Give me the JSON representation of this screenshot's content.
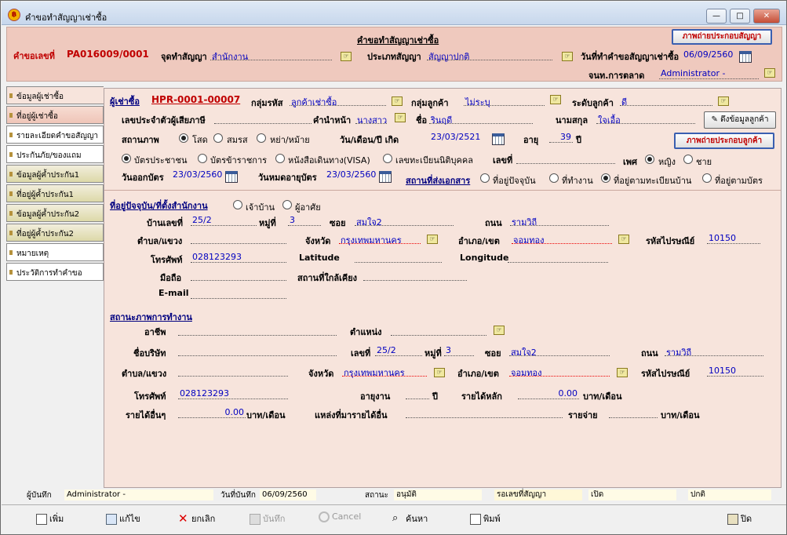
{
  "window": {
    "title": "คำขอทำสัญญาเช่าซื้อ",
    "minimize": "—",
    "maximize": "□",
    "close": "✕"
  },
  "header": {
    "form_title": "คำขอทำสัญญาเช่าซื้อ",
    "print_contract_btn": "ภาพถ่ายประกอบสัญญา",
    "request_no_label": "คำขอเลขที่",
    "request_no": "PA016009/0001",
    "place_label": "จุดทำสัญญา",
    "place": "สำนักงาน",
    "type_label": "ประเภทสัญญา",
    "type": "สัญญาปกติ",
    "date_label": "วันที่ทำคำขอสัญญาเช่าซื้อ",
    "date": "06/09/2560",
    "officer_label": "จนท.การตลาด",
    "officer": "Administrator -"
  },
  "tabs": [
    "ข้อมูลผู้เช่าซื้อ",
    "ที่อยู่ผู้เช่าซื้อ",
    "รายละเอียดคำขอสัญญา",
    "ประกันภัย/ของแถม",
    "ข้อมูลผู้ค้ำประกัน1",
    "ที่อยู่ผู้ค้ำประกัน1",
    "ข้อมูลผู้ค้ำประกัน2",
    "ที่อยู่ผู้ค้ำประกัน2",
    "หมายเหตุ",
    "ประวัติการทำคำขอ"
  ],
  "customer": {
    "label": "ผู้เช่าซื้อ",
    "id": "HPR-0001-00007",
    "group_code_label": "กลุ่มรหัส",
    "group_code": "ลูกค้าเช่าซื้อ",
    "group_label": "กลุ่มลูกค้า",
    "group": "ไม่ระบุ",
    "level_label": "ระดับลูกค้า",
    "level": "ดี",
    "taxid_label": "เลขประจำตัวผู้เสียภาษี",
    "prefix_label": "คำนำหน้า",
    "prefix": "นางสาว",
    "name_label": "ชื่อ",
    "name": "รินฤดี",
    "surname_label": "นามสกุล",
    "surname": "ใจเอื้อ",
    "pull_btn": "ดึงข้อมูลลูกค้า",
    "marital_label": "สถานภาพ",
    "marital": [
      "โสด",
      "สมรส",
      "หย่า/หม้าย"
    ],
    "dob_label": "วัน/เดือน/ปี เกิด",
    "dob": "23/03/2521",
    "age_label": "อายุ",
    "age": "39",
    "age_unit": "ปี",
    "photo_btn": "ภาพถ่ายประกอบลูกค้า",
    "idtype": [
      "บัตรประชาชน",
      "บัตรข้าราชการ",
      "หนังสือเดินทาง(VISA)",
      "เลขทะเบียนนิติบุคคล"
    ],
    "idno_label": "เลขที่",
    "sex_label": "เพศ",
    "sex": [
      "หญิง",
      "ชาย"
    ],
    "issue_label": "วันออกบัตร",
    "issue": "23/03/2560",
    "expire_label": "วันหมดอายุบัตร",
    "expire": "23/03/2560",
    "doc_addr_label": "สถานที่ส่งเอกสาร",
    "doc_addr": [
      "ที่อยู่ปัจจุบัน",
      "ที่ทำงาน",
      "ที่อยู่ตามทะเบียนบ้าน",
      "ที่อยู่ตามบัตร"
    ]
  },
  "address": {
    "section": "ที่อยู่ปัจจุบัน/ที่ตั้งสำนักงาน",
    "own": [
      "เจ้าบ้าน",
      "ผู้อาศัย"
    ],
    "house_label": "บ้านเลขที่",
    "house": "25/2",
    "moo_label": "หมู่ที่",
    "moo": "3",
    "soi_label": "ซอย",
    "soi": "สมใจ2",
    "road_label": "ถนน",
    "road": "รามวิถี",
    "tambon_label": "ตำบล/แขวง",
    "province_label": "จังหวัด",
    "province": "กรุงเทพมหานคร",
    "amphoe_label": "อำเภอ/เขต",
    "amphoe": "จอมทอง",
    "zip_label": "รหัสไปรษณีย์",
    "zip": "10150",
    "phone_label": "โทรศัพท์",
    "phone": "028123293",
    "lat_label": "Latitude",
    "lng_label": "Longitude",
    "mobile_label": "มือถือ",
    "near_label": "สถานที่ใกล้เคียง",
    "email_label": "E-mail"
  },
  "work": {
    "section": "สถานะภาพการทำงาน",
    "job_label": "อาชีพ",
    "position_label": "ตำแหน่ง",
    "company_label": "ชื่อบริษัท",
    "no_label": "เลขที่",
    "no": "25/2",
    "moo_label": "หมู่ที่",
    "moo": "3",
    "soi_label": "ซอย",
    "soi": "สมใจ2",
    "road_label": "ถนน",
    "road": "รามวิถี",
    "tambon_label": "ตำบล/แขวง",
    "province_label": "จังหวัด",
    "province": "กรุงเทพมหานคร",
    "amphoe_label": "อำเภอ/เขต",
    "amphoe": "จอมทอง",
    "zip_label": "รหัสไปรษณีย์",
    "zip": "10150",
    "phone_label": "โทรศัพท์",
    "phone": "028123293",
    "tenure_label": "อายุงาน",
    "tenure_unit": "ปี",
    "income_label": "รายได้หลัก",
    "income": "0.00",
    "income_unit": "บาท/เดือน",
    "other_label": "รายได้อื่นๆ",
    "other": "0.00",
    "other_unit": "บาท/เดือน",
    "source_label": "แหล่งที่มารายได้อื่น",
    "expense_label": "รายจ่าย",
    "expense_unit": "บาท/เดือน"
  },
  "status": {
    "recorder_label": "ผู้บันทึก",
    "recorder": "Administrator -",
    "rec_date_label": "วันที่บันทึก",
    "rec_date": "06/09/2560",
    "state_label": "สถานะ",
    "state": "อนุมัติ",
    "wait_label": "รอเลขที่สัญญา",
    "open": "เปิด",
    "normal": "ปกติ"
  },
  "toolbar": {
    "add": "เพิ่ม",
    "edit": "แก้ไข",
    "cancel": "ยกเลิก",
    "save": "บันทึก",
    "cancel_en": "Cancel",
    "search": "ค้นหา",
    "print": "พิมพ์",
    "close": "ปิด"
  }
}
